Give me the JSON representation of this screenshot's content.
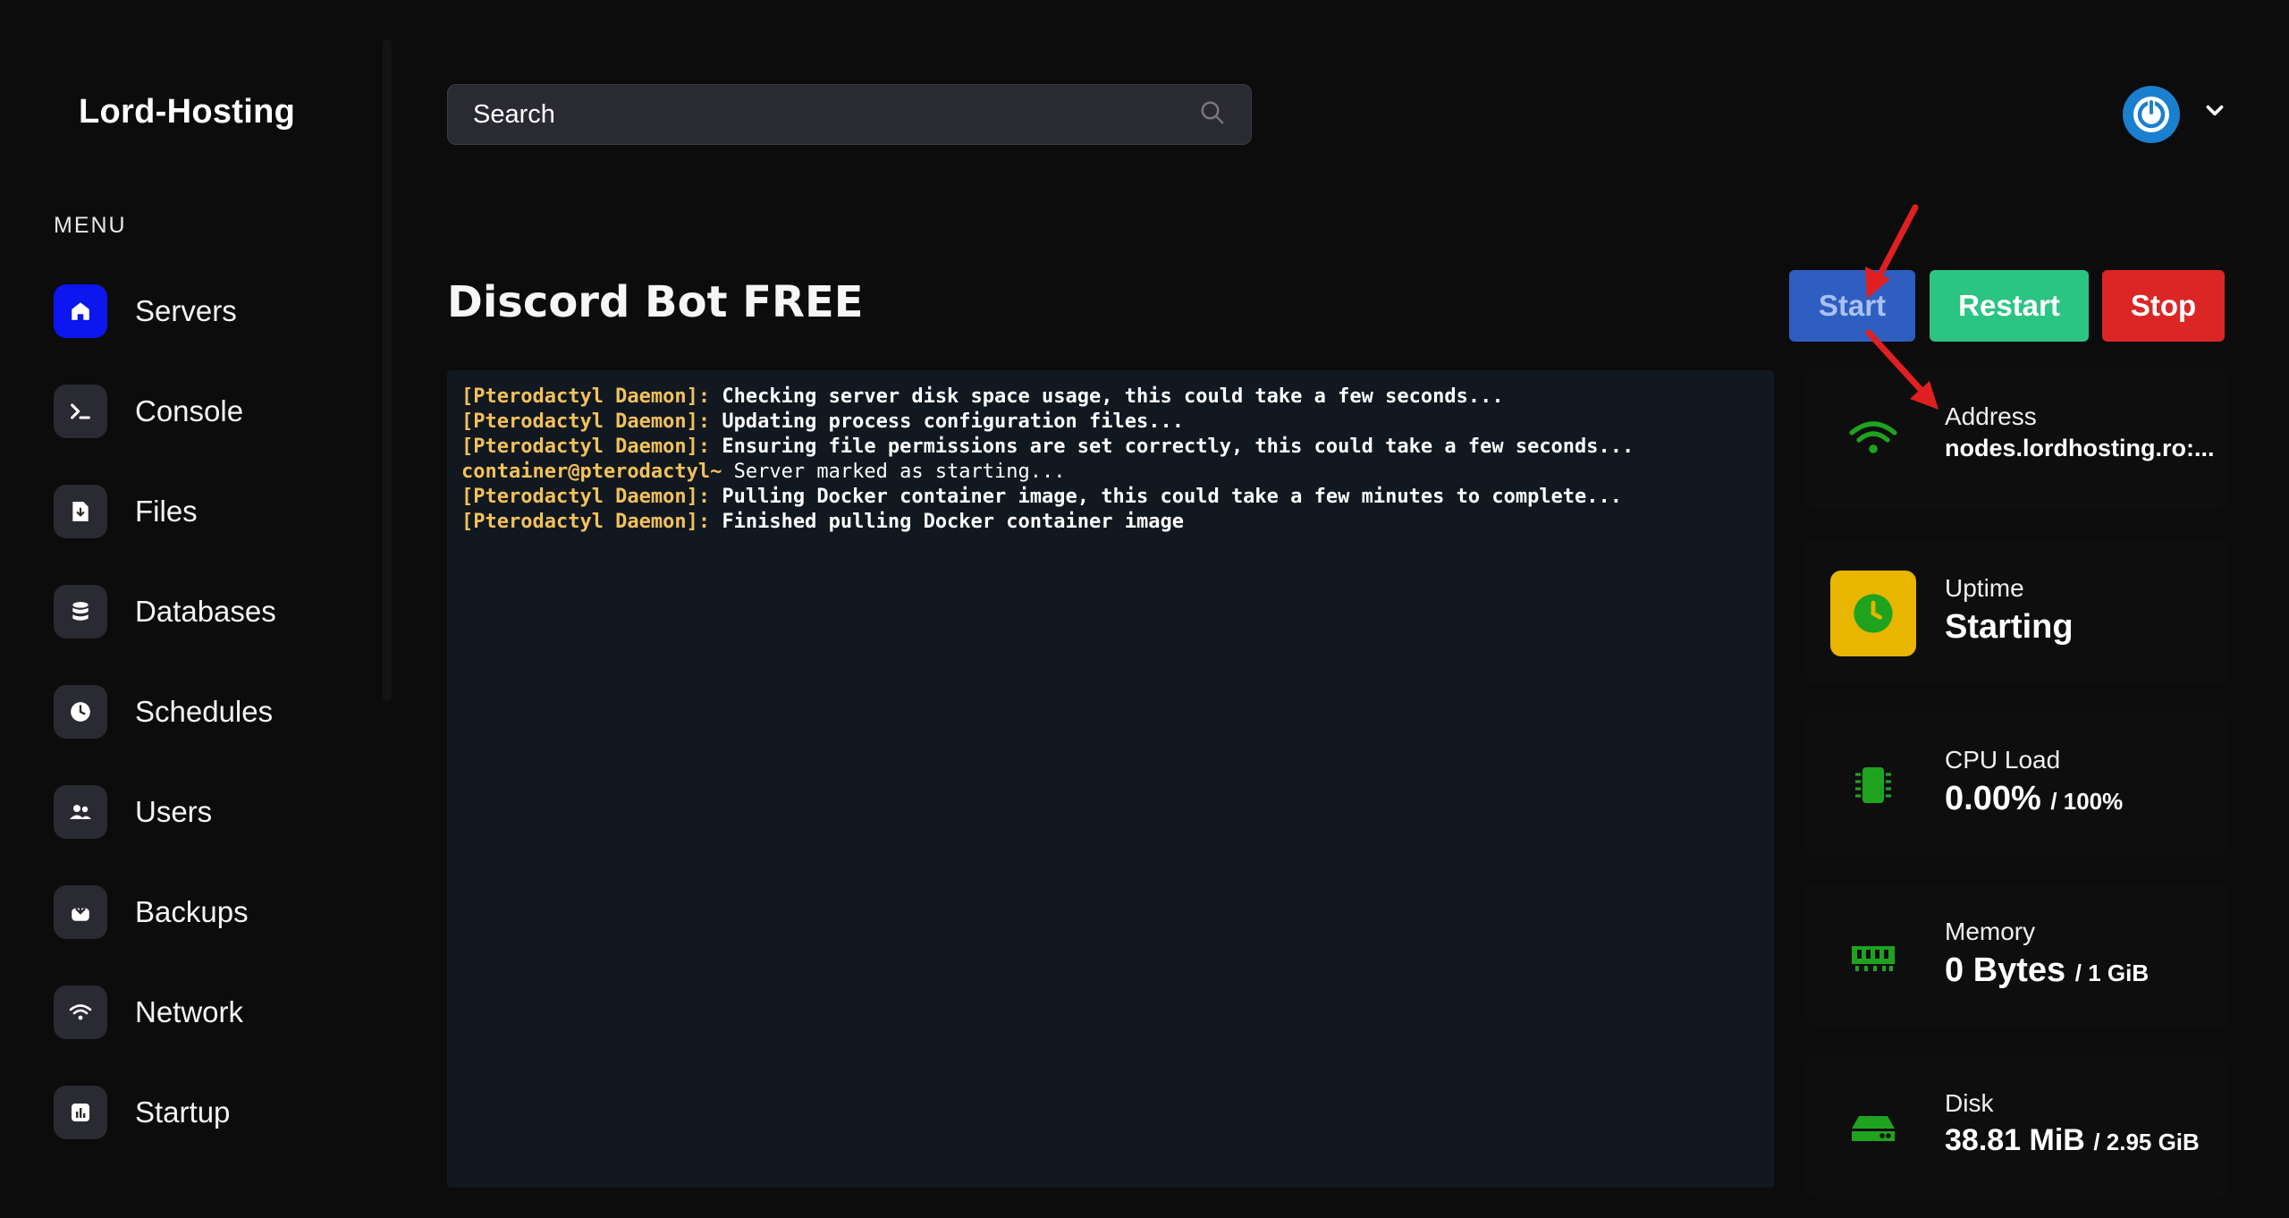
{
  "brand": "Lord-Hosting",
  "menu_label": "MENU",
  "nav": [
    {
      "label": "Servers",
      "icon": "home-icon",
      "active": true
    },
    {
      "label": "Console",
      "icon": "terminal-icon"
    },
    {
      "label": "Files",
      "icon": "file-icon"
    },
    {
      "label": "Databases",
      "icon": "database-icon"
    },
    {
      "label": "Schedules",
      "icon": "clock-icon"
    },
    {
      "label": "Users",
      "icon": "users-icon"
    },
    {
      "label": "Backups",
      "icon": "backup-icon"
    },
    {
      "label": "Network",
      "icon": "wifi-icon"
    },
    {
      "label": "Startup",
      "icon": "chart-icon"
    }
  ],
  "search": {
    "placeholder": "Search"
  },
  "server": {
    "title": "Discord Bot FREE"
  },
  "controls": {
    "start": "Start",
    "restart": "Restart",
    "stop": "Stop"
  },
  "console": {
    "lines": [
      {
        "prefix": "[Pterodactyl Daemon]:",
        "text": " Checking server disk space usage, this could take a few seconds..."
      },
      {
        "prefix": "[Pterodactyl Daemon]:",
        "text": " Updating process configuration files..."
      },
      {
        "prefix": "[Pterodactyl Daemon]:",
        "text": " Ensuring file permissions are set correctly, this could take a few seconds..."
      },
      {
        "prefix": "container@pterodactyl~",
        "text": " Server marked as starting..."
      },
      {
        "prefix": "[Pterodactyl Daemon]:",
        "text": " Pulling Docker container image, this could take a few minutes to complete..."
      },
      {
        "prefix": "[Pterodactyl Daemon]:",
        "text": " Finished pulling Docker container image"
      }
    ]
  },
  "stats": {
    "address": {
      "label": "Address",
      "value": "nodes.lordhosting.ro:..."
    },
    "uptime": {
      "label": "Uptime",
      "value": "Starting"
    },
    "cpu": {
      "label": "CPU Load",
      "value": "0.00%",
      "unit": "/ 100%"
    },
    "memory": {
      "label": "Memory",
      "value": "0 Bytes",
      "unit": "/ 1 GiB"
    },
    "disk": {
      "label": "Disk",
      "value": "38.81 MiB",
      "unit": "/ 2.95 GiB"
    }
  },
  "colors": {
    "accent_blue": "#0c16ef",
    "start": "#2e5ec0",
    "restart": "#2cc482",
    "stop": "#dc2626",
    "uptime_bg": "#e8b500",
    "stat_green": "#1fa31f",
    "console_prefix": "#f3c15a"
  }
}
